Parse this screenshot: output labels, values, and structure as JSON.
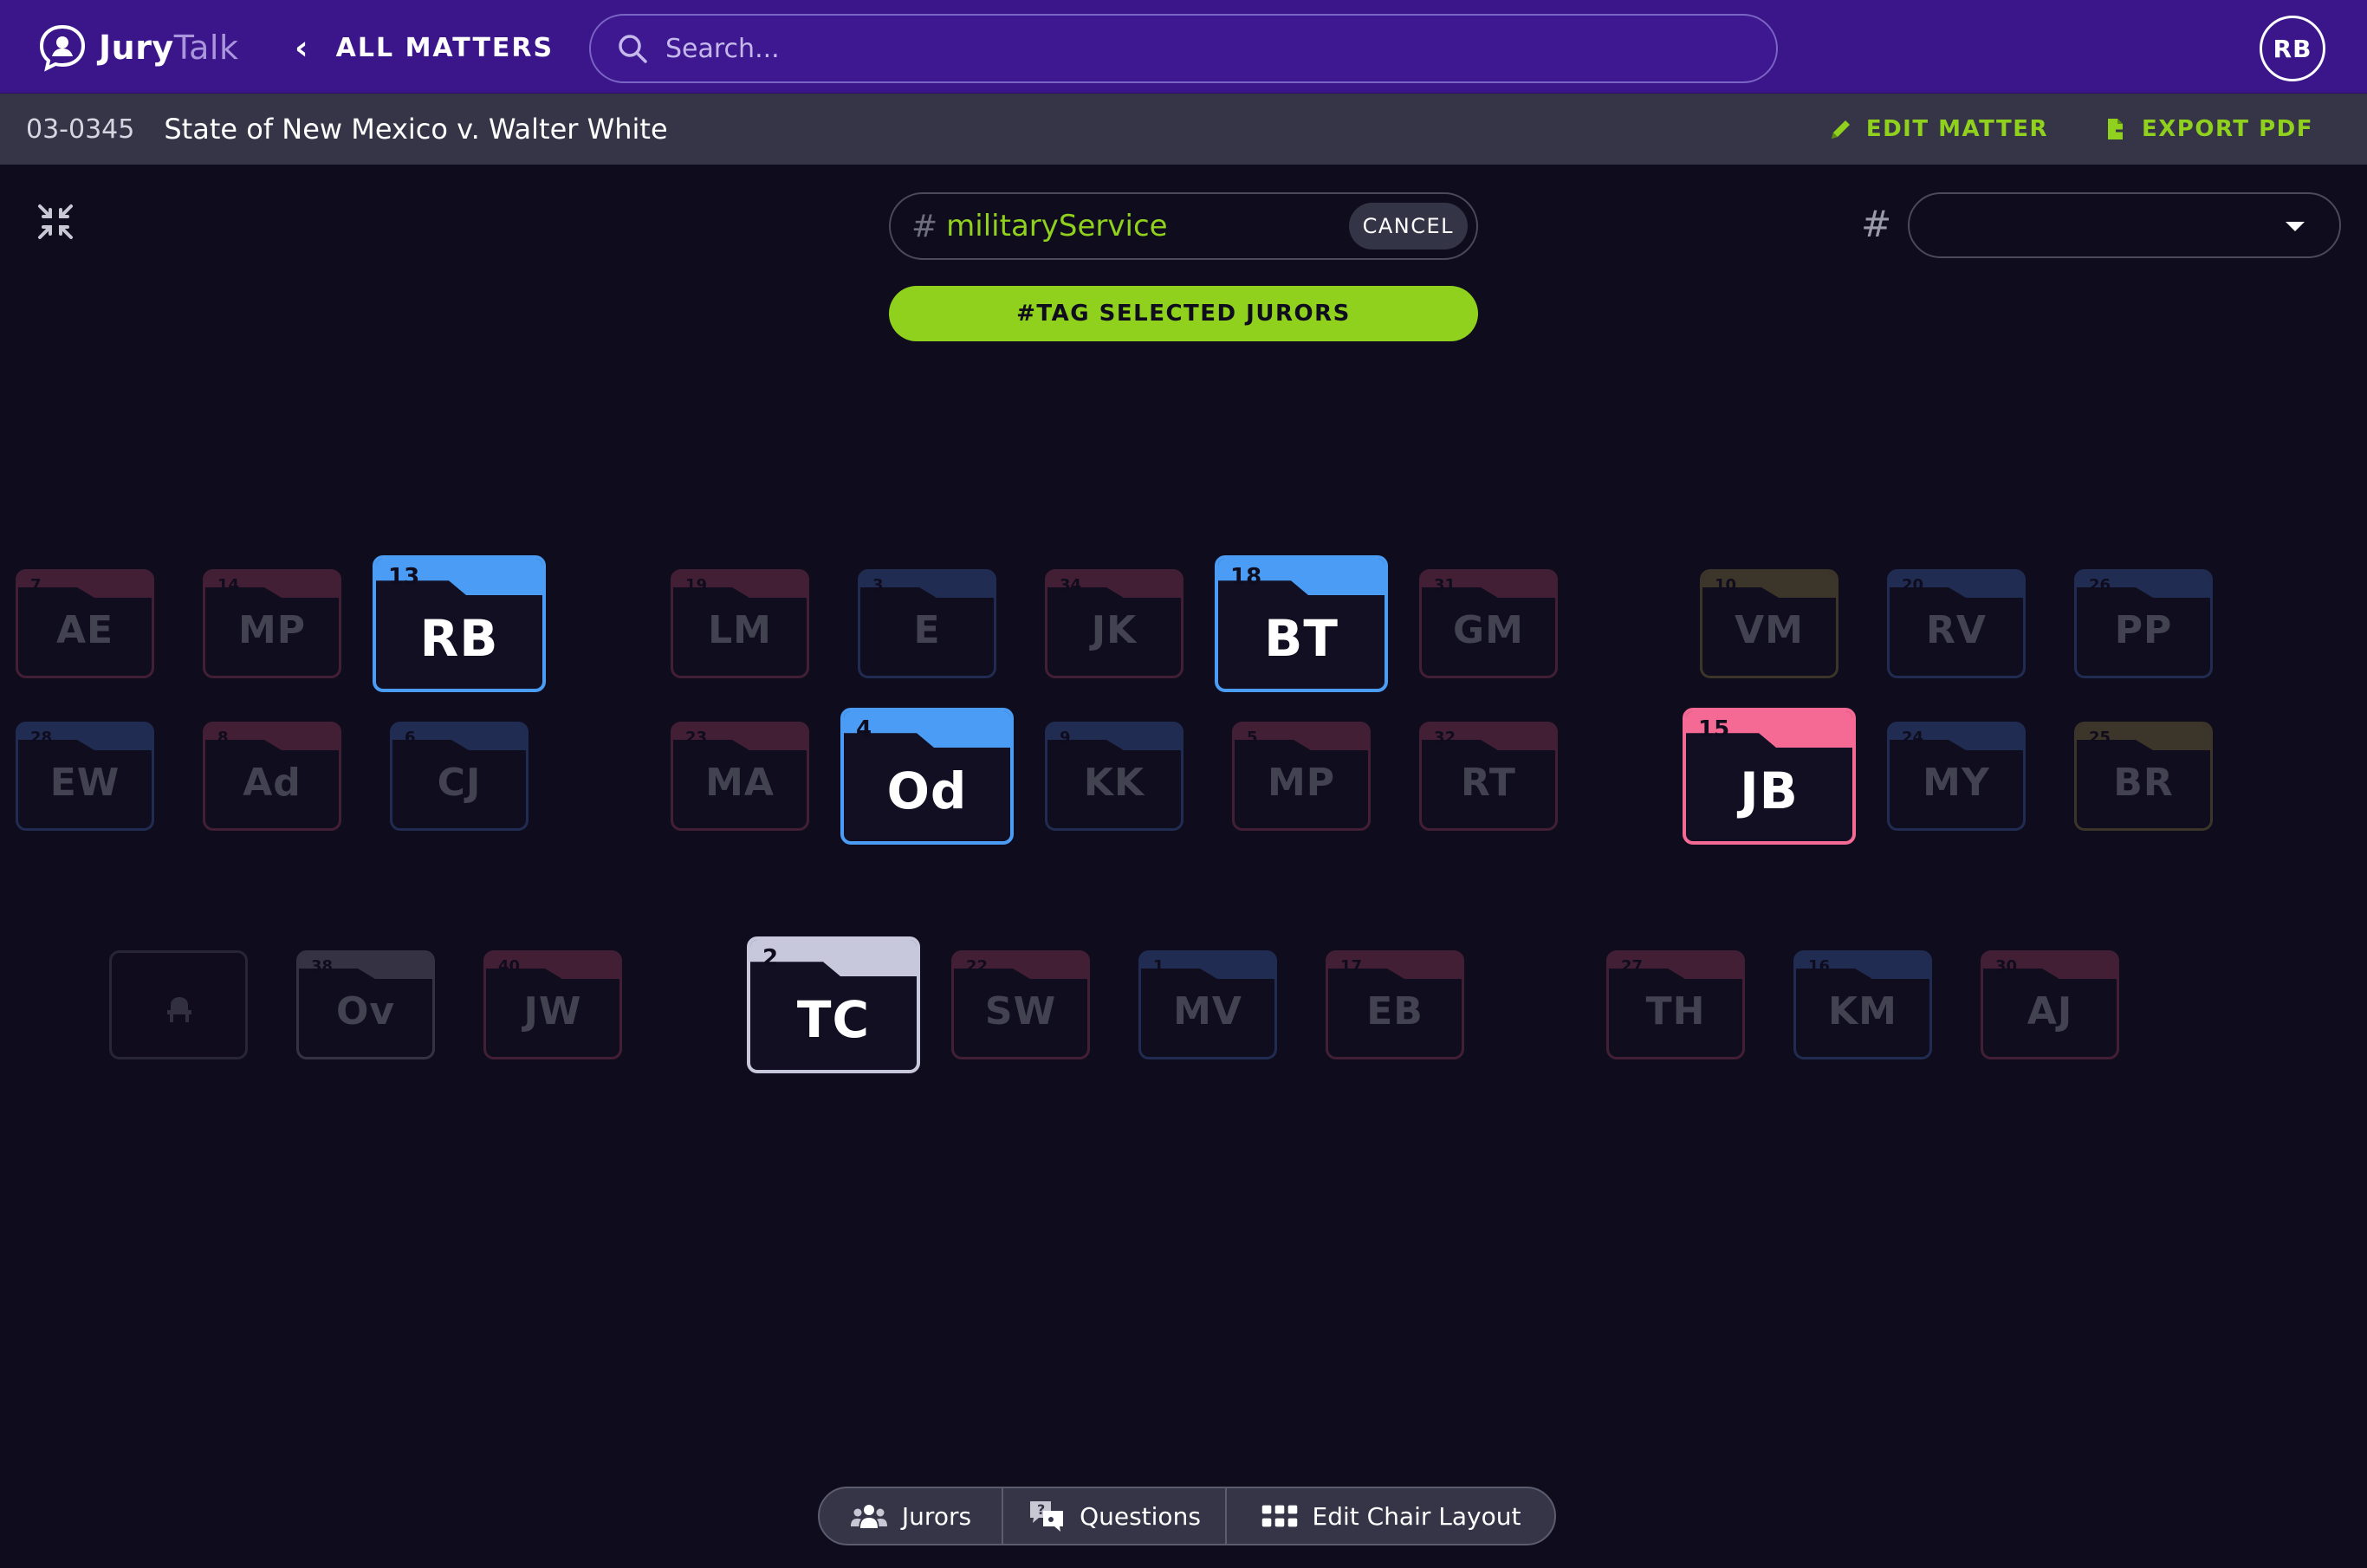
{
  "header": {
    "logo_bold": "Jury",
    "logo_light": "Talk",
    "back_label": "ALL MATTERS",
    "search_placeholder": "Search...",
    "user_initials": "RB"
  },
  "matter": {
    "id": "03-0345",
    "title": "State of New Mexico v. Walter White",
    "edit_label": "EDIT MATTER",
    "export_label": "EXPORT PDF"
  },
  "toolbar": {
    "tag_prefix": "#",
    "tag_value": "militaryService",
    "cancel_label": "CANCEL",
    "tag_button_label": "#TAG SELECTED JURORS",
    "filter_prefix": "#",
    "filter_value": ""
  },
  "colors": {
    "red": "#8a3a58",
    "blue": "#3a5a9c",
    "olive": "#7a6e3a",
    "gray": "#6a6a78",
    "sel_blue": "#4a9cf4",
    "sel_pink": "#f46a94",
    "sel_white": "#c8c8dc",
    "accent": "#8fd11d"
  },
  "seats": [
    {
      "num": "7",
      "initials": "AE",
      "color": "red",
      "selected": false
    },
    {
      "num": "14",
      "initials": "MP",
      "color": "red",
      "selected": false
    },
    {
      "num": "13",
      "initials": "RB",
      "color": "sel_blue",
      "selected": true
    },
    {
      "num": "19",
      "initials": "LM",
      "color": "red",
      "selected": false
    },
    {
      "num": "3",
      "initials": "E",
      "color": "blue",
      "selected": false
    },
    {
      "num": "34",
      "initials": "JK",
      "color": "red",
      "selected": false
    },
    {
      "num": "18",
      "initials": "BT",
      "color": "sel_blue",
      "selected": true
    },
    {
      "num": "31",
      "initials": "GM",
      "color": "red",
      "selected": false
    },
    {
      "num": "10",
      "initials": "VM",
      "color": "olive",
      "selected": false
    },
    {
      "num": "20",
      "initials": "RV",
      "color": "blue",
      "selected": false
    },
    {
      "num": "26",
      "initials": "PP",
      "color": "blue",
      "selected": false
    },
    {
      "num": "28",
      "initials": "EW",
      "color": "blue",
      "selected": false
    },
    {
      "num": "8",
      "initials": "Ad",
      "color": "red",
      "selected": false
    },
    {
      "num": "6",
      "initials": "CJ",
      "color": "blue",
      "selected": false
    },
    {
      "num": "23",
      "initials": "MA",
      "color": "red",
      "selected": false
    },
    {
      "num": "4",
      "initials": "Od",
      "color": "sel_blue",
      "selected": true
    },
    {
      "num": "9",
      "initials": "KK",
      "color": "blue",
      "selected": false
    },
    {
      "num": "5",
      "initials": "MP",
      "color": "red",
      "selected": false
    },
    {
      "num": "32",
      "initials": "RT",
      "color": "red",
      "selected": false
    },
    {
      "num": "15",
      "initials": "JB",
      "color": "sel_pink",
      "selected": true
    },
    {
      "num": "24",
      "initials": "MY",
      "color": "blue",
      "selected": false
    },
    {
      "num": "25",
      "initials": "BR",
      "color": "olive",
      "selected": false
    },
    {
      "num": "",
      "initials": "",
      "color": "gray",
      "selected": false,
      "empty": true
    },
    {
      "num": "38",
      "initials": "Ov",
      "color": "gray",
      "selected": false
    },
    {
      "num": "40",
      "initials": "JW",
      "color": "red",
      "selected": false
    },
    {
      "num": "2",
      "initials": "TC",
      "color": "sel_white",
      "selected": true
    },
    {
      "num": "22",
      "initials": "SW",
      "color": "red",
      "selected": false
    },
    {
      "num": "1",
      "initials": "MV",
      "color": "blue",
      "selected": false
    },
    {
      "num": "17",
      "initials": "EB",
      "color": "red",
      "selected": false
    },
    {
      "num": "27",
      "initials": "TH",
      "color": "red",
      "selected": false
    },
    {
      "num": "16",
      "initials": "KM",
      "color": "blue",
      "selected": false
    },
    {
      "num": "30",
      "initials": "AJ",
      "color": "red",
      "selected": false
    }
  ],
  "bottom_tabs": {
    "jurors": "Jurors",
    "questions": "Questions",
    "edit_layout": "Edit Chair Layout"
  }
}
